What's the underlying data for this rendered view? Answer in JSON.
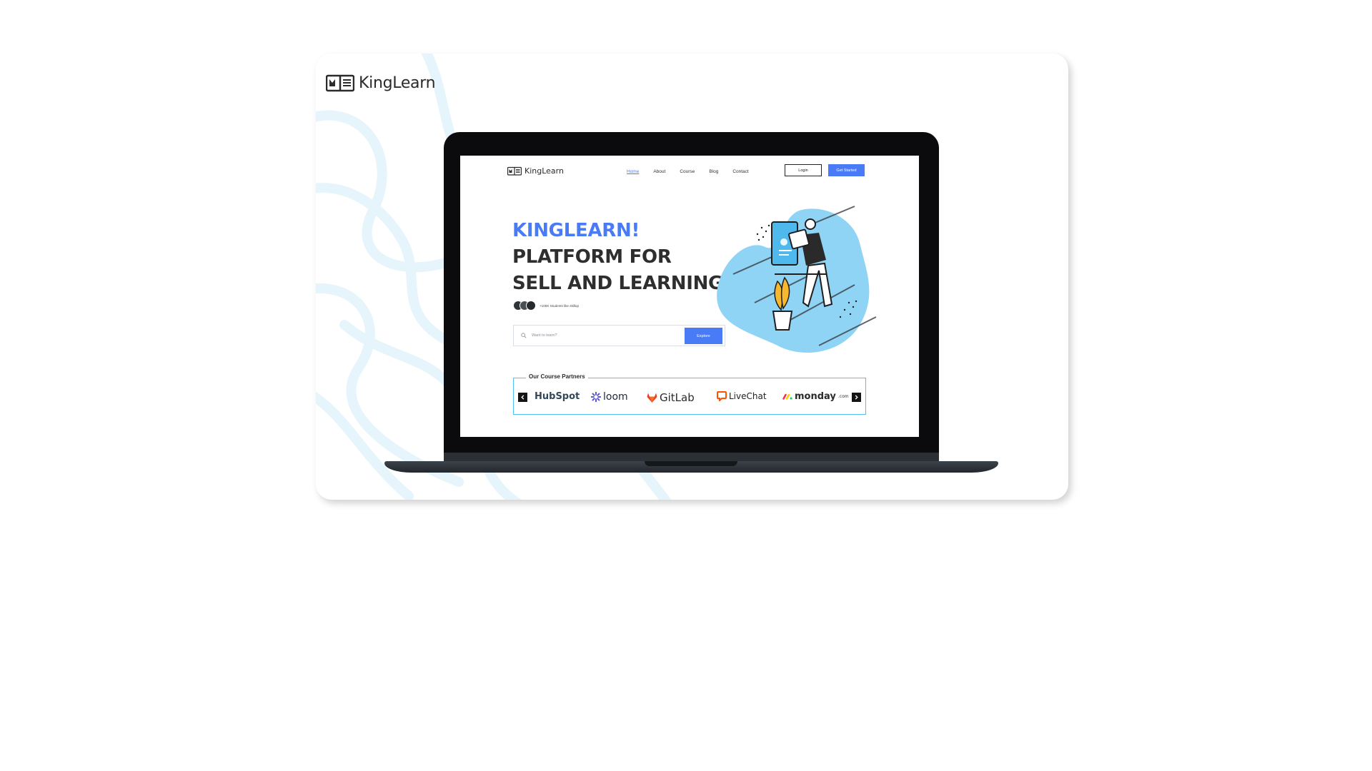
{
  "brand": {
    "name": "KingLearn"
  },
  "nav": {
    "items": [
      {
        "label": "Home",
        "active": true
      },
      {
        "label": "About",
        "active": false
      },
      {
        "label": "Course",
        "active": false
      },
      {
        "label": "Blog",
        "active": false
      },
      {
        "label": "Contact",
        "active": false
      }
    ],
    "login_label": "Login",
    "get_started_label": "Get Started"
  },
  "hero": {
    "line1": "KINGLEARN!",
    "line2": "PLATFORM FOR",
    "line3": "SELL AND LEARNING",
    "students_text": "+100K Students like skillup"
  },
  "search": {
    "placeholder": "Want to learn?",
    "button_label": "Explore"
  },
  "partners": {
    "title": "Our Course Partners",
    "logos": [
      "HubSpot",
      "loom",
      "GitLab",
      "LiveChat",
      "monday",
      ".com"
    ]
  },
  "colors": {
    "accent": "#4a7bf7",
    "partner_border": "#4fc3f7",
    "illustration_blob": "#8fd4f5"
  }
}
